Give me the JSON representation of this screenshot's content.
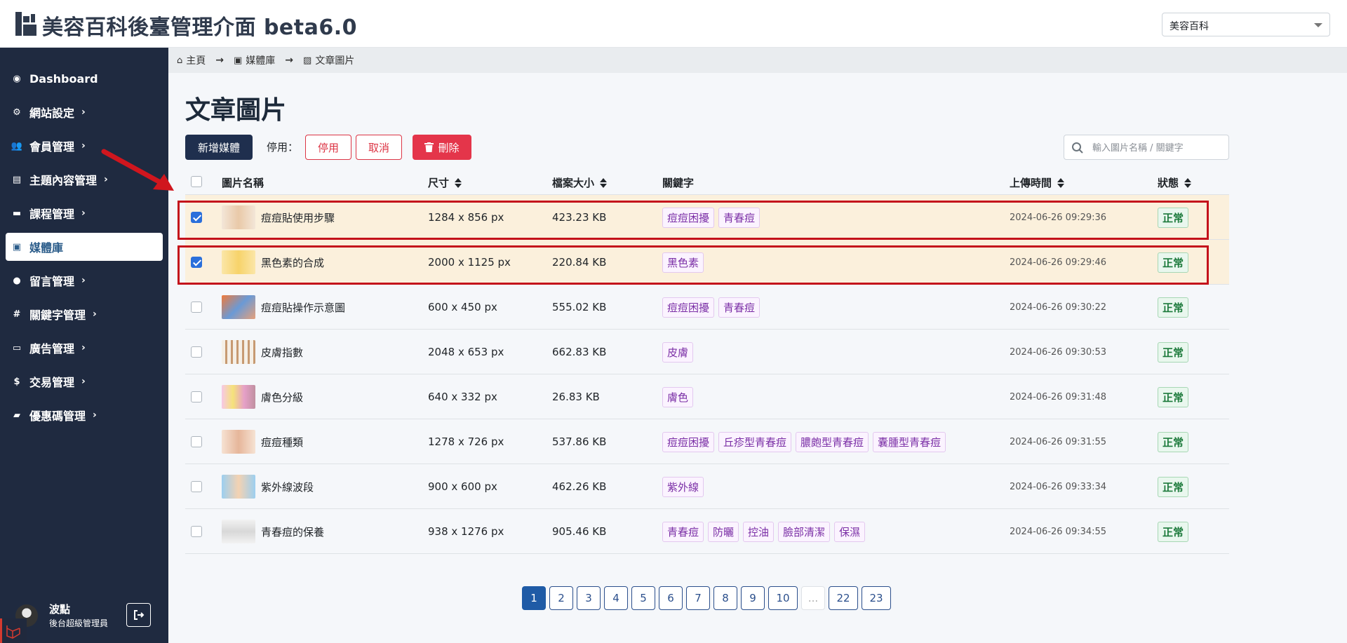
{
  "header": {
    "title": "美容百科後臺管理介面 beta6.0",
    "site_select": "美容百科"
  },
  "sidebar": {
    "items": [
      {
        "label": "Dashboard",
        "icon": "palette-icon",
        "has_children": false
      },
      {
        "label": "網站設定",
        "icon": "gear-icon",
        "has_children": true
      },
      {
        "label": "會員管理",
        "icon": "users-icon",
        "has_children": true
      },
      {
        "label": "主題內容管理",
        "icon": "newspaper-icon",
        "has_children": true
      },
      {
        "label": "課程管理",
        "icon": "book-icon",
        "has_children": true
      },
      {
        "label": "媒體庫",
        "icon": "images-icon",
        "has_children": false,
        "active": true
      },
      {
        "label": "留言管理",
        "icon": "comment-icon",
        "has_children": true
      },
      {
        "label": "關鍵字管理",
        "icon": "hashtag-icon",
        "has_children": true
      },
      {
        "label": "廣告管理",
        "icon": "ad-icon",
        "has_children": true
      },
      {
        "label": "交易管理",
        "icon": "money-bag-icon",
        "has_children": true
      },
      {
        "label": "優惠碼管理",
        "icon": "ticket-icon",
        "has_children": true
      }
    ],
    "user": {
      "name": "波點",
      "role": "後台超級管理員"
    }
  },
  "breadcrumb": [
    {
      "label": "主頁",
      "icon": "home-icon"
    },
    {
      "label": "媒體庫",
      "icon": "images-icon"
    },
    {
      "label": "文章圖片",
      "icon": "image-icon"
    }
  ],
  "page": {
    "title": "文章圖片",
    "add_button": "新增媒體",
    "disable_label": "停用：",
    "disable_button": "停用",
    "cancel_button": "取消",
    "delete_button": "刪除",
    "search_placeholder": "輸入圖片名稱 / 關鍵字"
  },
  "table": {
    "columns": [
      "圖片名稱",
      "尺寸",
      "檔案大小",
      "關鍵字",
      "上傳時間",
      "狀態"
    ],
    "rows": [
      {
        "checked": true,
        "name": "痘痘貼使用步驟",
        "size": "1284 x 856 px",
        "filesize": "423.23 KB",
        "tags": [
          "痘痘困擾",
          "青春痘"
        ],
        "time": "2024-06-26 09:29:36",
        "status": "正常"
      },
      {
        "checked": true,
        "name": "黑色素的合成",
        "size": "2000 x 1125 px",
        "filesize": "220.84 KB",
        "tags": [
          "黑色素"
        ],
        "time": "2024-06-26 09:29:46",
        "status": "正常"
      },
      {
        "checked": false,
        "name": "痘痘貼操作示意圖",
        "size": "600 x 450 px",
        "filesize": "555.02 KB",
        "tags": [
          "痘痘困擾",
          "青春痘"
        ],
        "time": "2024-06-26 09:30:22",
        "status": "正常"
      },
      {
        "checked": false,
        "name": "皮膚指數",
        "size": "2048 x 653 px",
        "filesize": "662.83 KB",
        "tags": [
          "皮膚"
        ],
        "time": "2024-06-26 09:30:53",
        "status": "正常"
      },
      {
        "checked": false,
        "name": "膚色分級",
        "size": "640 x 332 px",
        "filesize": "26.83 KB",
        "tags": [
          "膚色"
        ],
        "time": "2024-06-26 09:31:48",
        "status": "正常"
      },
      {
        "checked": false,
        "name": "痘痘種類",
        "size": "1278 x 726 px",
        "filesize": "537.86 KB",
        "tags": [
          "痘痘困擾",
          "丘疹型青春痘",
          "膿皰型青春痘",
          "囊腫型青春痘"
        ],
        "time": "2024-06-26 09:31:55",
        "status": "正常"
      },
      {
        "checked": false,
        "name": "紫外線波段",
        "size": "900 x 600 px",
        "filesize": "462.26 KB",
        "tags": [
          "紫外線"
        ],
        "time": "2024-06-26 09:33:34",
        "status": "正常"
      },
      {
        "checked": false,
        "name": "青春痘的保養",
        "size": "938 x 1276 px",
        "filesize": "905.46 KB",
        "tags": [
          "青春痘",
          "防曬",
          "控油",
          "臉部清潔",
          "保濕"
        ],
        "time": "2024-06-26 09:34:55",
        "status": "正常"
      }
    ]
  },
  "pagination": {
    "pages": [
      "1",
      "2",
      "3",
      "4",
      "5",
      "6",
      "7",
      "8",
      "9",
      "10",
      "...",
      "22",
      "23"
    ],
    "current": "1"
  },
  "colors": {
    "sidebar_bg": "#1f2a40",
    "highlight_border": "#c4121b",
    "selected_row_bg": "#fbf0dc",
    "tag_text": "#7b2fa6",
    "status_text": "#1c7a3b"
  }
}
